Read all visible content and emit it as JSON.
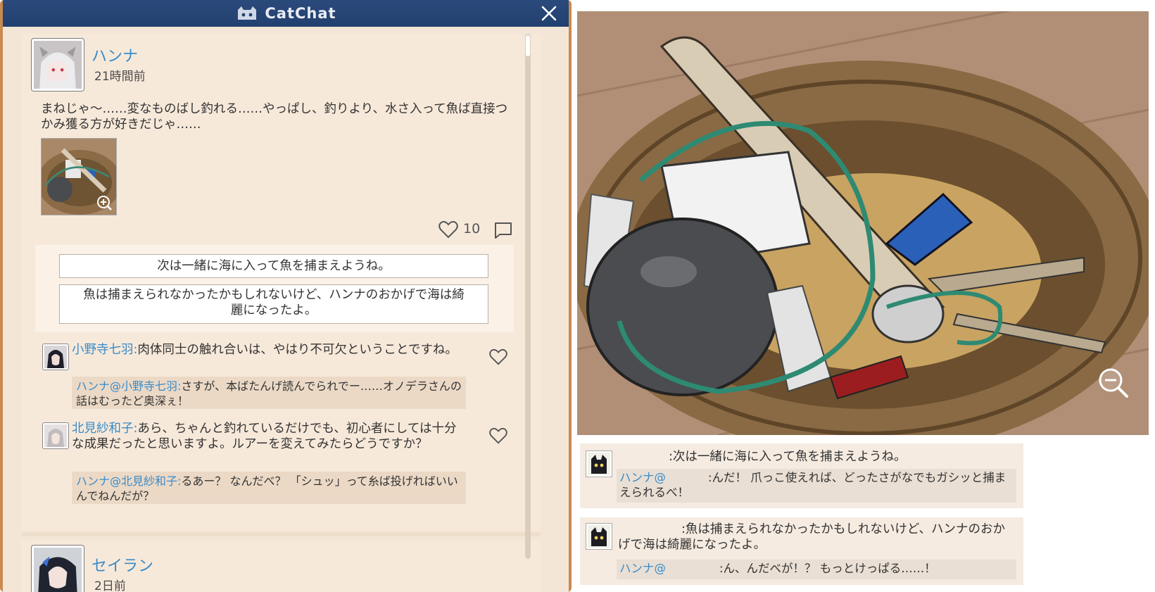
{
  "app": {
    "title": "CatChat"
  },
  "post1": {
    "name": "ハンナ",
    "time": "21時間前",
    "text": "まねじゃ～……変なものばし釣れる……やっぱし、釣りより、水さ入って魚ば直接つかみ獲る方が好きだじゃ……",
    "likes": "10",
    "reply_options": [
      "次は一緒に海に入って魚を捕まえようね。",
      "魚は捕まえられなかったかもしれないけど、ハンナのおかげで海は綺麗になったよ。"
    ],
    "comments": [
      {
        "name": "小野寺七羽:",
        "text": "肉体同士の触れ合いは、やはり不可欠ということですね。",
        "reply_name": "ハンナ@",
        "reply_target": "小野寺七羽:",
        "reply_text": "さすが、本ばたんげ読んでられでー……オノデラさんの話はむったど奥深ぇ！"
      },
      {
        "name": "北見紗和子:",
        "text": "あら、ちゃんと釣れているだけでも、初心者にしては十分な成果だったと思いますよ。ルアーを変えてみたらどうですか？",
        "reply_name": "ハンナ@",
        "reply_target": "北見紗和子:",
        "reply_text": "るあー？ なんだべ？ 「シュッ」って糸ば投げればいいんでねんだが？"
      }
    ]
  },
  "post2": {
    "name": "セイラン",
    "time": "2日前"
  },
  "chat": [
    {
      "line": ":次は一緒に海に入って魚を捕まえようね。",
      "reply_name": "ハンナ@",
      "reply_text": ":んだ！ 爪っこ使えれば、どったさがなでもガシッと捕まえられるべ！"
    },
    {
      "line": ":魚は捕まえられなかったかもしれないけど、ハンナのおかげで海は綺麗になったよ。",
      "reply_name": "ハンナ@",
      "reply_text": ":ん、んだべが！？ もっとけっぱる……！"
    }
  ],
  "colors": {
    "accent_name": "#3a8bc8",
    "titlebar": "#22406f",
    "frame": "#c98a4e"
  },
  "icons": [
    "cat-logo-icon",
    "close-icon",
    "zoom-in-icon",
    "heart-icon",
    "comment-icon",
    "zoom-out-icon"
  ]
}
